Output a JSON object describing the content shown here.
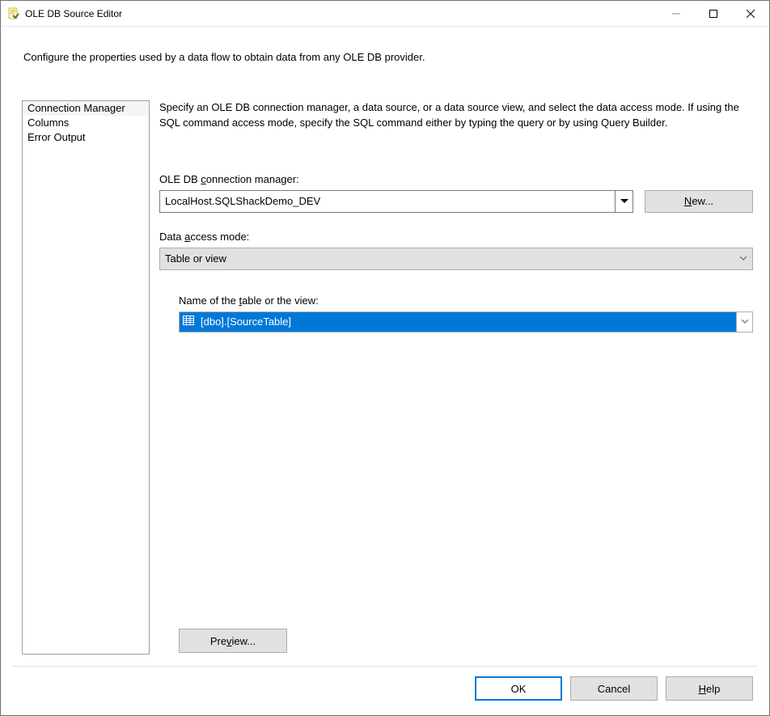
{
  "title": "OLE DB Source Editor",
  "intro": "Configure the properties used by a data flow to obtain data from any OLE DB provider.",
  "nav": {
    "items": [
      {
        "label": "Connection Manager"
      },
      {
        "label": "Columns"
      },
      {
        "label": "Error Output"
      }
    ]
  },
  "panel": {
    "description": "Specify an OLE DB connection manager, a data source, or a data source view, and select the data access mode. If using the SQL command access mode, specify the SQL command either by typing the query or by using Query Builder.",
    "conn_label_pre": "OLE DB ",
    "conn_label_accel": "c",
    "conn_label_post": "onnection manager:",
    "conn_value": "LocalHost.SQLShackDemo_DEV",
    "new_btn_accel": "N",
    "new_btn_post": "ew...",
    "access_label_pre": "Data ",
    "access_label_accel": "a",
    "access_label_post": "ccess mode:",
    "access_value": "Table or view",
    "table_label_pre": "Name of the ",
    "table_label_accel": "t",
    "table_label_post": "able or the view:",
    "table_value": "[dbo].[SourceTable]",
    "preview_pre": "Pre",
    "preview_accel": "v",
    "preview_post": "iew..."
  },
  "footer": {
    "ok": "OK",
    "cancel": "Cancel",
    "help_accel": "H",
    "help_post": "elp"
  }
}
